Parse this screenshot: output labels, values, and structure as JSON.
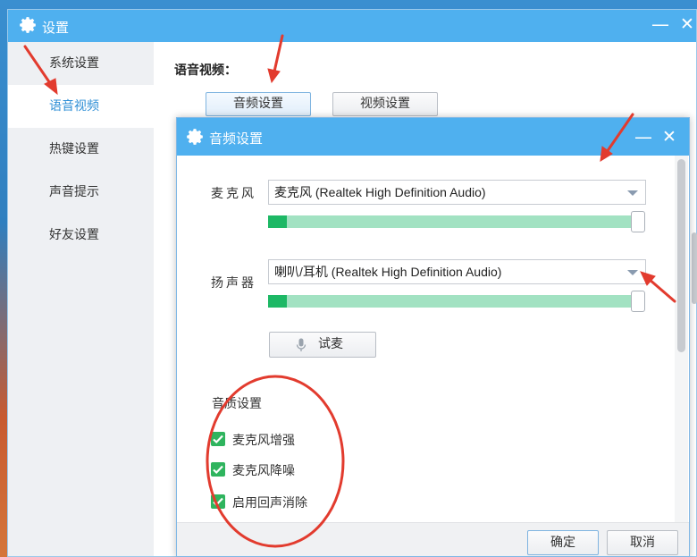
{
  "outer_window": {
    "title": "设置",
    "minimize": "—",
    "close": "✕",
    "sidebar": [
      {
        "label": "系统设置",
        "active": false
      },
      {
        "label": "语音视频",
        "active": true
      },
      {
        "label": "热键设置",
        "active": false
      },
      {
        "label": "声音提示",
        "active": false
      },
      {
        "label": "好友设置",
        "active": false
      }
    ],
    "section_heading": "语音视频：",
    "tabs": [
      {
        "label": "音频设置",
        "selected": true
      },
      {
        "label": "视频设置",
        "selected": false
      }
    ]
  },
  "dialog": {
    "title": "音频设置",
    "minimize": "—",
    "close": "✕",
    "microphone": {
      "label": "麦克风",
      "selected": "麦克风 (Realtek High Definition Audio)",
      "level_fraction": 0.05
    },
    "speaker": {
      "label": "扬声器",
      "selected": "喇叭/耳机 (Realtek High Definition Audio)",
      "level_fraction": 0.05
    },
    "test_mic_button": "试麦",
    "quality_heading": "音质设置",
    "options": [
      {
        "label": "麦克风增强",
        "checked": true
      },
      {
        "label": "麦克风降噪",
        "checked": true
      },
      {
        "label": "启用回声消除",
        "checked": true
      }
    ],
    "ok_button": "确定",
    "cancel_button": "取消"
  },
  "icons": {
    "title_icon": "gear-icon",
    "mic_icon": "microphone-icon",
    "check_icon": "checkmark-icon"
  },
  "colors": {
    "titlebar": "#4fb0ef",
    "active_nav_text": "#2f8fd6",
    "meter_fill": "#1db865",
    "meter_track": "#a2e2c2",
    "checkbox": "#2fb45e",
    "annotation": "#e23b2e"
  }
}
